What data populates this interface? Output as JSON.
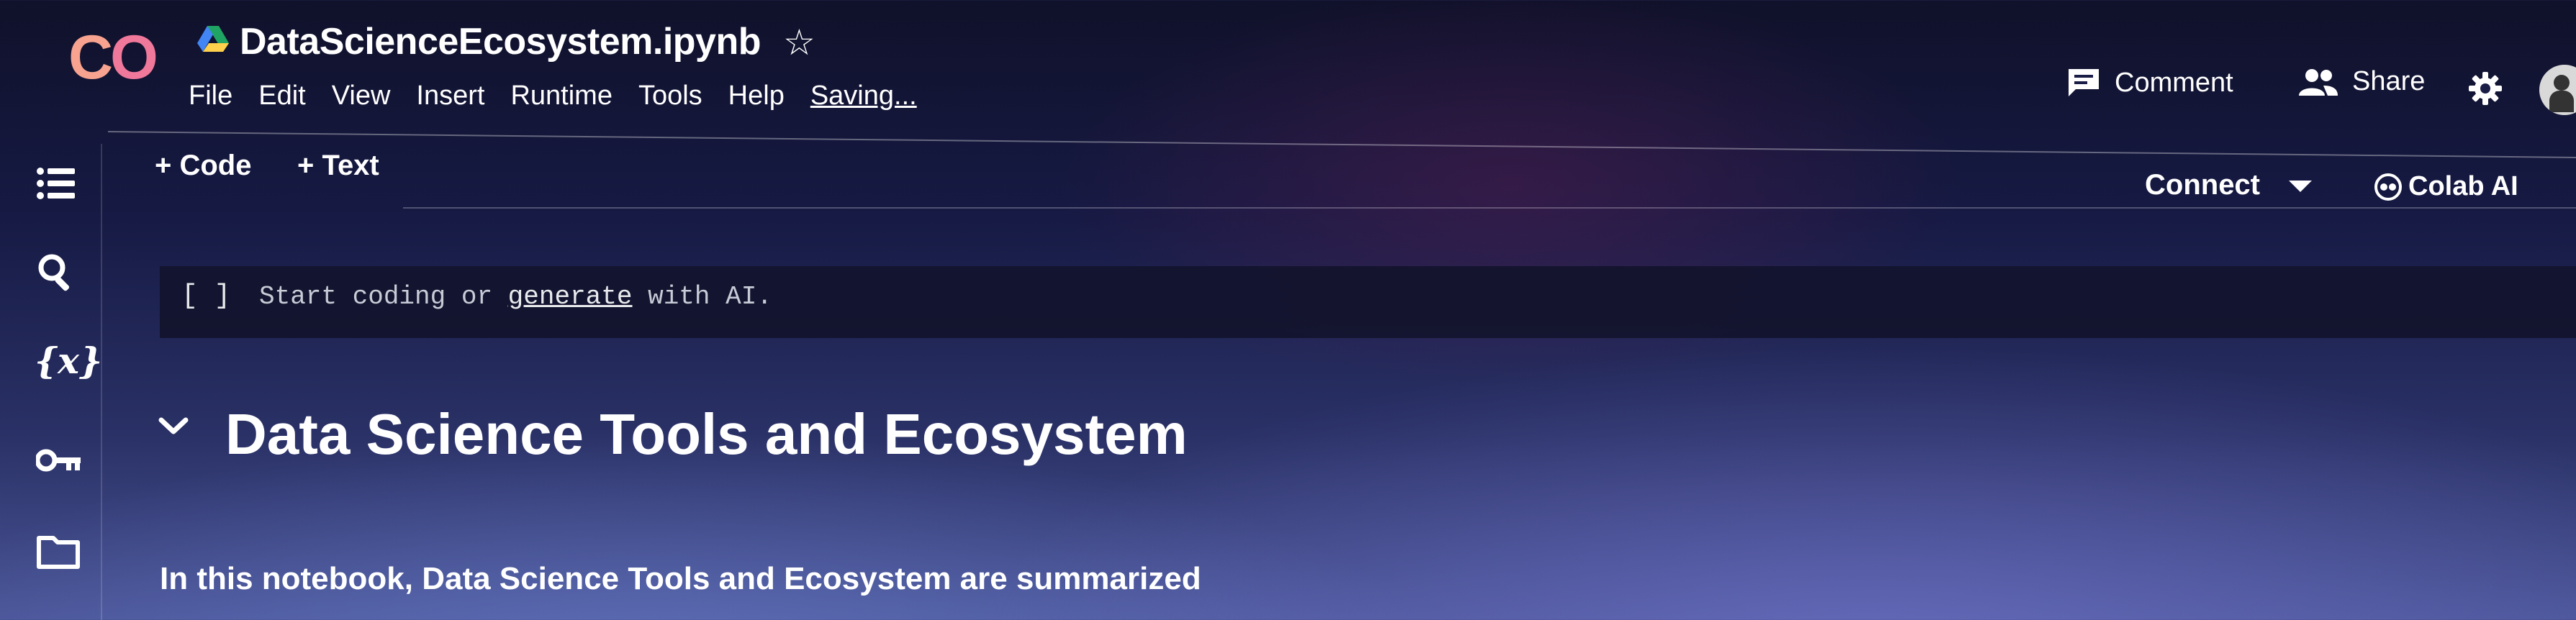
{
  "header": {
    "logo_text": "CO",
    "title": "DataScienceEcosystem.ipynb",
    "menu": [
      "File",
      "Edit",
      "View",
      "Insert",
      "Runtime",
      "Tools",
      "Help"
    ],
    "status": "Saving...",
    "comment_label": "Comment",
    "share_label": "Share"
  },
  "toolbar": {
    "add_code": "+ Code",
    "add_text": "+ Text",
    "connect": "Connect",
    "colab_ai": "Colab AI"
  },
  "cell": {
    "bracket": "[ ]",
    "prefix": "Start coding or ",
    "link": "generate",
    "suffix": " with AI."
  },
  "notebook": {
    "heading": "Data Science Tools and Ecosystem",
    "paragraph": "In this notebook, Data Science Tools and Ecosystem are summarized"
  },
  "rail_icons": [
    "toc-icon",
    "search-icon",
    "variables-icon",
    "key-icon",
    "folder-icon"
  ],
  "colors": {
    "logo_orange": "#f9ab00",
    "logo_pink": "#e8568c",
    "text": "#ffffff"
  }
}
